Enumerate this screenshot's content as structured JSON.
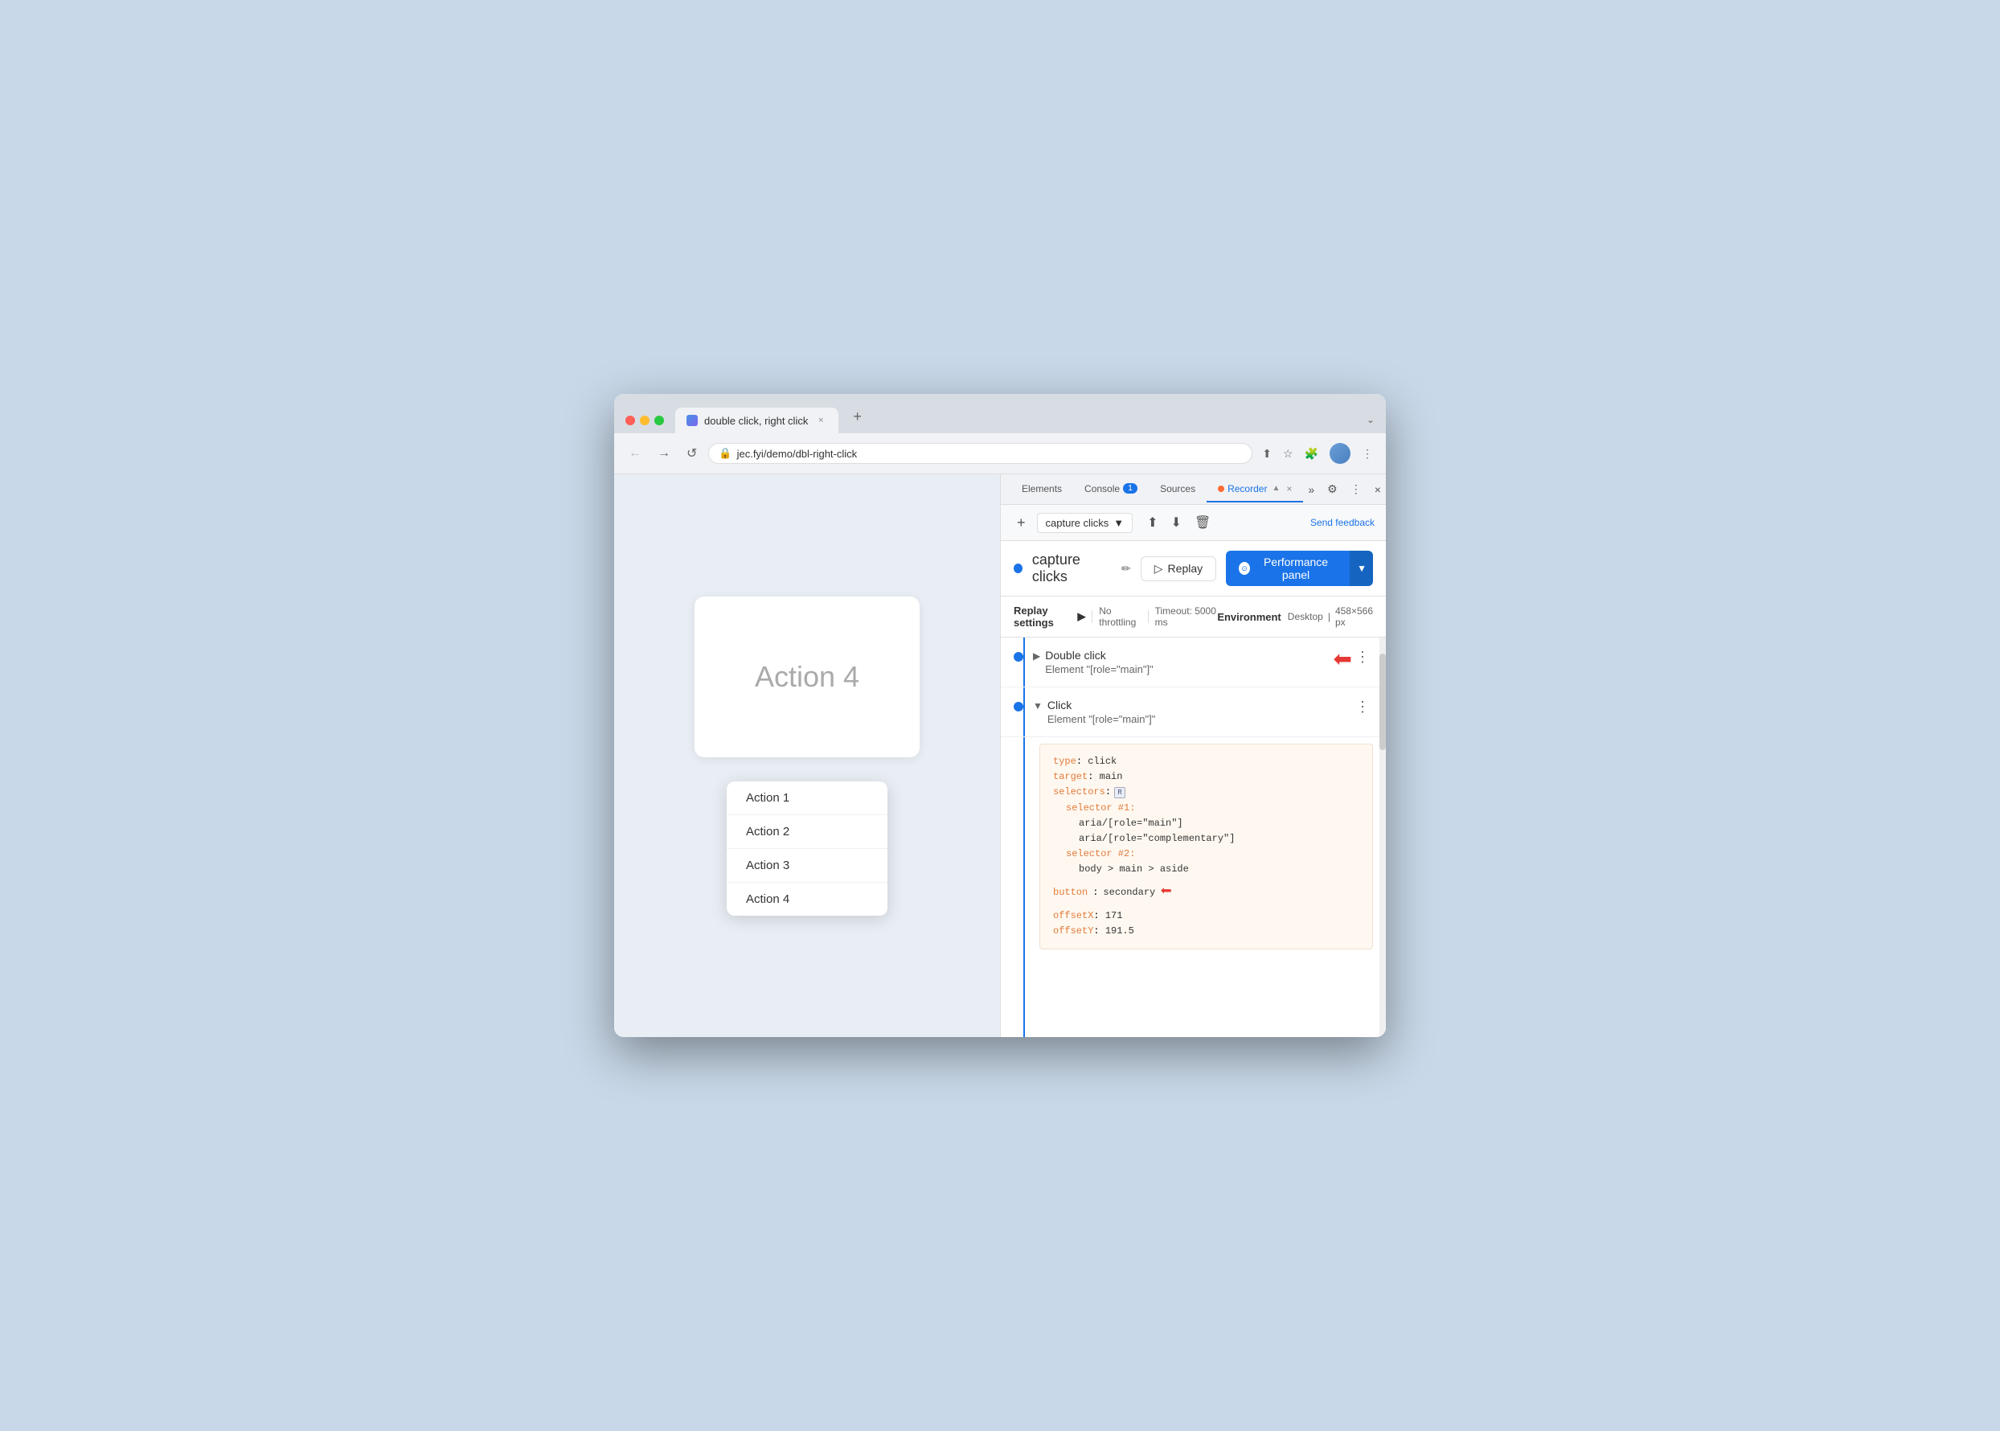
{
  "browser": {
    "tab_title": "double click, right click",
    "tab_new_label": "+",
    "address": "jec.fyi/demo/dbl-right-click",
    "chevron": "⌄"
  },
  "nav": {
    "back_label": "←",
    "forward_label": "→",
    "reload_label": "↺"
  },
  "devtools": {
    "tabs": [
      "Elements",
      "Console",
      "Sources",
      "Recorder"
    ],
    "recorder_tab": "Recorder",
    "console_badge": "1",
    "close_label": "×",
    "more_tabs_label": "»"
  },
  "recorder_toolbar": {
    "add_label": "+",
    "recording_name": "capture clicks",
    "send_feedback": "Send feedback"
  },
  "recorder_header": {
    "title": "capture clicks",
    "replay_label": "Replay",
    "performance_panel_label": "Performance panel"
  },
  "replay_settings": {
    "title": "Replay settings",
    "arrow": "▶",
    "throttling": "No throttling",
    "timeout": "Timeout: 5000 ms",
    "environment_label": "Environment",
    "desktop": "Desktop",
    "resolution": "458×566 px"
  },
  "steps": [
    {
      "id": "step1",
      "expand": "▶",
      "title": "Double click",
      "subtitle": "Element \"[role=\"main\"]\"",
      "has_arrow": true
    },
    {
      "id": "step2",
      "expand": "▼",
      "title": "Click",
      "subtitle": "Element \"[role=\"main\"]\"",
      "has_arrow": false,
      "code": {
        "type_key": "type",
        "type_value": "click",
        "target_key": "target",
        "target_value": "main",
        "selectors_key": "selectors",
        "selector1_key": "selector #1:",
        "aria1": "aria/[role=\"main\"]",
        "aria2": "aria/[role=\"complementary\"]",
        "selector2_key": "selector #2:",
        "body_selector": "body > main > aside",
        "button_key": "button",
        "button_value": "secondary",
        "button_has_arrow": true,
        "offsetx_key": "offsetX",
        "offsetx_value": "171",
        "offsety_key": "offsetY",
        "offsety_value": "191.5"
      }
    }
  ],
  "webpage": {
    "action4_text": "Action 4",
    "menu_items": [
      "Action 1",
      "Action 2",
      "Action 3",
      "Action 4"
    ]
  }
}
